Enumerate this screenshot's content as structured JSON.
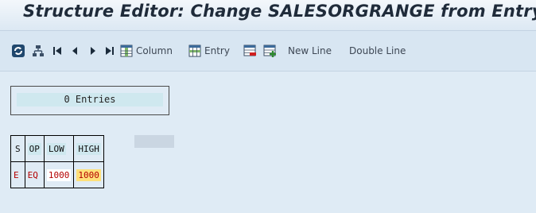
{
  "title": "Structure Editor: Change SALESORGRANGE from Entry",
  "toolbar": {
    "column_label": "Column",
    "entry_label": "Entry",
    "new_line_label": "New Line",
    "double_line_label": "Double Line"
  },
  "entries_text": "0 Entries",
  "table": {
    "headers": [
      "S",
      "OP",
      "LOW",
      "HIGH"
    ],
    "row": [
      "E",
      "EQ",
      "1000",
      "1000"
    ]
  }
}
